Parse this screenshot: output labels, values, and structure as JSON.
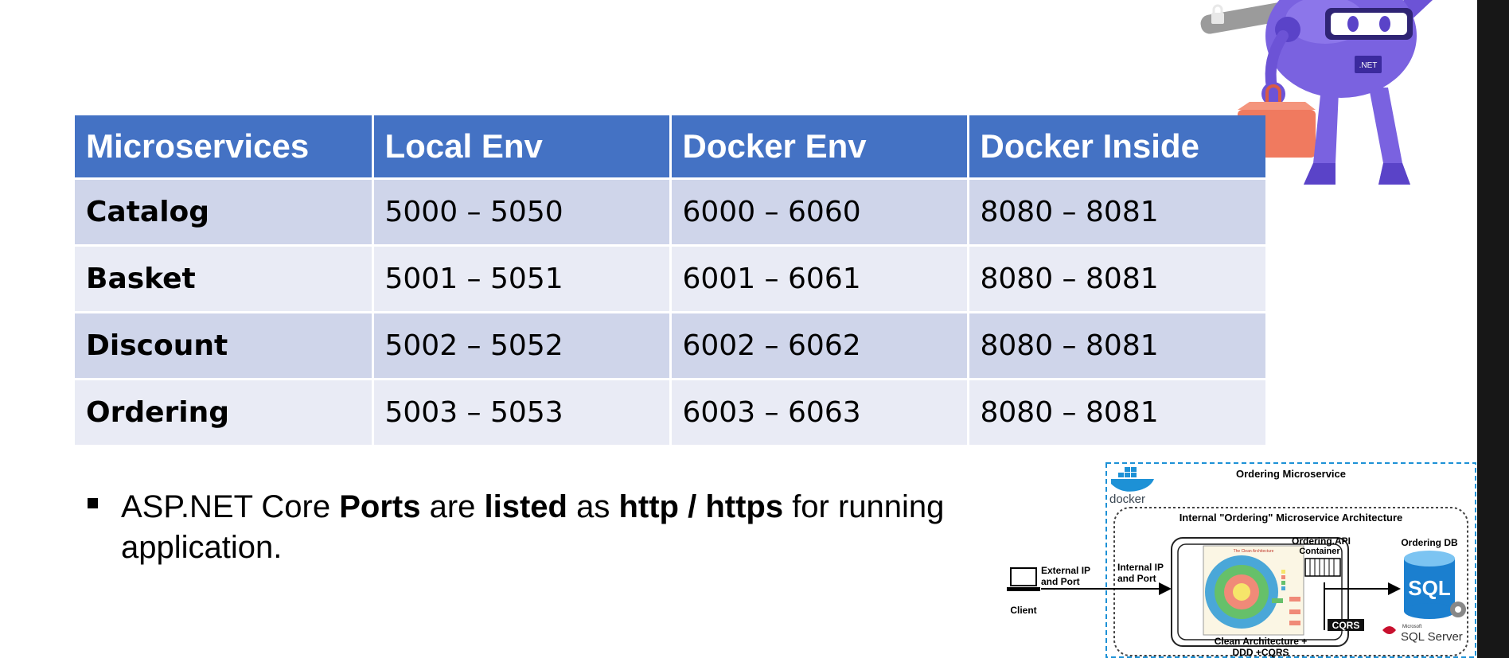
{
  "table": {
    "headers": [
      "Microservices",
      "Local Env",
      "Docker Env",
      "Docker Inside"
    ],
    "rows": [
      [
        "Catalog",
        "5000 – 5050",
        "6000 – 6060",
        "8080 – 8081"
      ],
      [
        "Basket",
        "5001 – 5051",
        "6001 – 6061",
        "8080 – 8081"
      ],
      [
        "Discount",
        "5002 – 5052",
        "6002 – 6062",
        "8080 – 8081"
      ],
      [
        "Ordering",
        "5003 – 5053",
        "6003 – 6063",
        "8080 – 8081"
      ]
    ]
  },
  "bullet": {
    "part1": "ASP.NET Core ",
    "part2": "Ports",
    "part3": " are ",
    "part4": "listed",
    "part5": " as ",
    "part6": "http / https",
    "part7": " for running application."
  },
  "mascot": {
    "badge": ".NET"
  },
  "diagram": {
    "title": "Ordering Microservice",
    "docker_label": "docker",
    "internal_title": "Internal \"Ordering\" Microservice Architecture",
    "external_ip_line1": "External IP",
    "external_ip_line2": "and Port",
    "client_label": "Client",
    "internal_ip_line1": "Internal IP",
    "internal_ip_line2": "and Port",
    "api_container_line1": "Ordering.API",
    "api_container_line2": "Container",
    "db_label": "Ordering DB",
    "sql_label": "SQL",
    "sql_server_small": "Microsoft",
    "sql_server_label": "SQL Server",
    "clean_arch_title": "The Clean Architecture",
    "cqrs_label": "CQRS",
    "clean_arch_line1": "Clean Architecture +",
    "clean_arch_line2": "DDD +CQRS"
  },
  "colors": {
    "header_bg": "#4472c4",
    "row_odd_bg": "#cfd5ea",
    "row_even_bg": "#e9ebf5",
    "mascot_purple": "#7a62e0",
    "docker_blue": "#1d91d6"
  }
}
